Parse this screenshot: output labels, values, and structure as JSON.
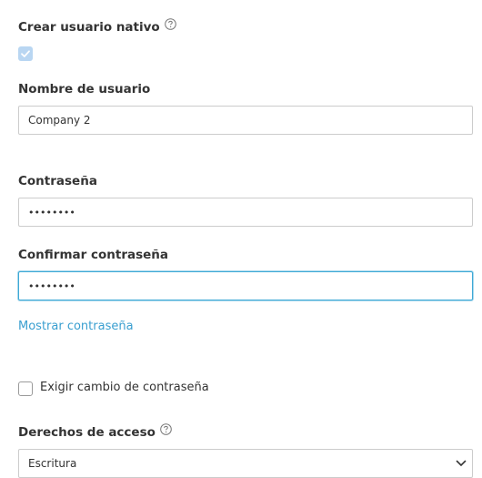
{
  "native_user": {
    "label": "Crear usuario nativo",
    "help_icon": "question-circle-icon",
    "checked": true
  },
  "username": {
    "label": "Nombre de usuario",
    "value": "Company 2"
  },
  "password": {
    "label": "Contraseña",
    "value_masked": "••••••••"
  },
  "confirm_password": {
    "label": "Confirmar contraseña",
    "value_masked": "••••••••"
  },
  "show_password_link": "Mostrar contraseña",
  "require_change": {
    "label": "Exigir cambio de contraseña",
    "checked": false
  },
  "access_rights": {
    "label": "Derechos de acceso",
    "help_icon": "question-circle-icon",
    "selected": "Escritura"
  },
  "colors": {
    "link": "#3a9fd0",
    "focus_border": "#3ea9d6",
    "checkbox_checked_bg": "#b9d6f2"
  }
}
